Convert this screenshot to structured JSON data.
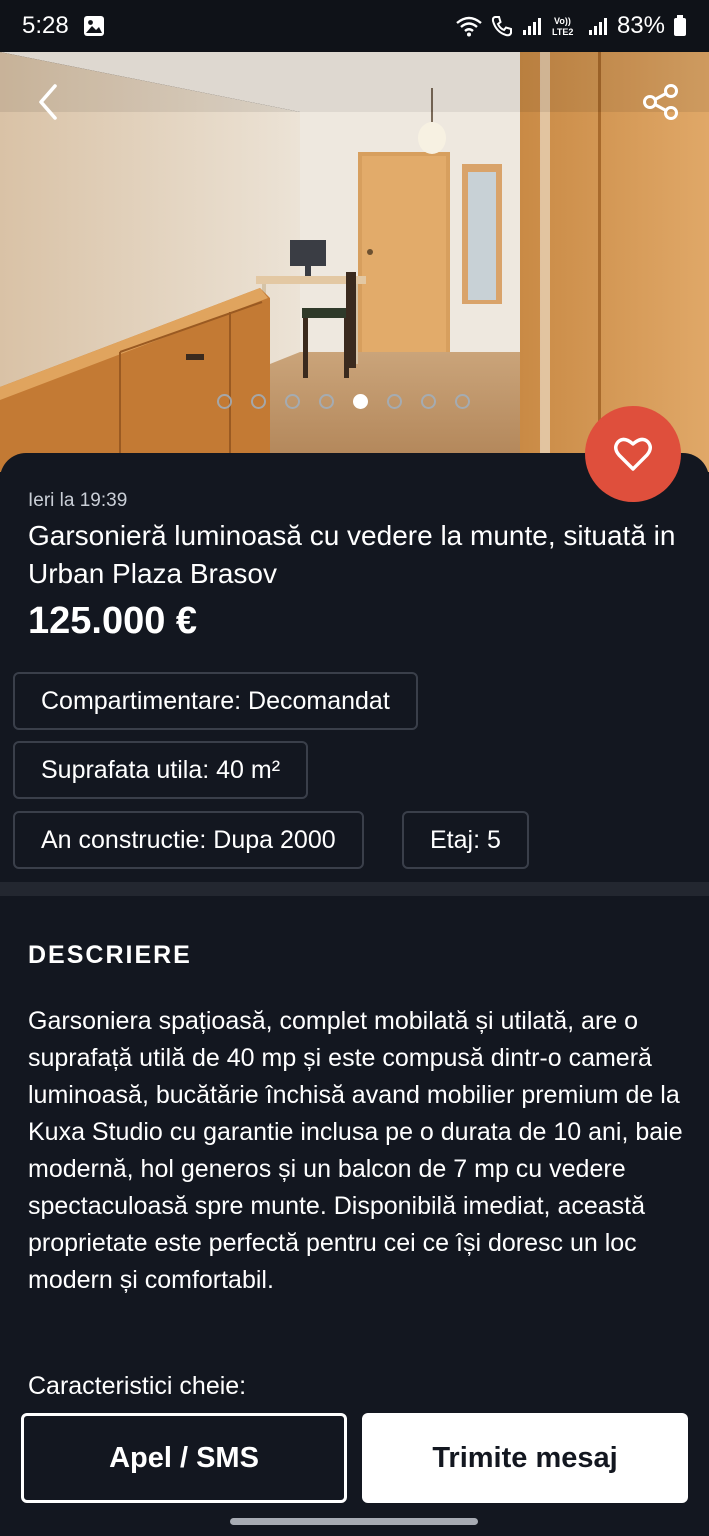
{
  "status_bar": {
    "time": "5:28",
    "battery": "83%",
    "icons": [
      "image-icon",
      "wifi-calling-icon",
      "phone-call-icon",
      "signal-icon",
      "volte-icon",
      "signal-icon",
      "battery-icon"
    ],
    "volte_text": "Vo)) LTE2"
  },
  "gallery": {
    "photo_count": 8,
    "active_index": 4,
    "icons": {
      "back": "back-arrow-icon",
      "share": "share-icon"
    }
  },
  "listing": {
    "posted": "Ieri la 19:39",
    "title": "Garsonieră luminoasă cu vedere la munte, situată in Urban Plaza Brasov",
    "price": "125.000 €",
    "favorite_icon": "heart-icon",
    "favorite_color": "#df4f3c",
    "attributes": [
      "Compartimentare: Decomandat",
      "Suprafata utila: 40 m²",
      "An constructie: Dupa 2000",
      "Etaj: 5"
    ]
  },
  "description": {
    "heading": "DESCRIERE",
    "text": "Garsoniera spațioasă, complet mobilată și utilată, are o suprafață utilă de 40 mp și este compusă dintr-o cameră luminoasă, bucătărie închisă avand mobilier premium de la Kuxa Studio cu garantie inclusa pe o durata de 10 ani, baie modernă, hol generos și un balcon de 7 mp cu vedere spectaculoasă spre munte. Disponibilă imediat, această proprietate este perfectă pentru cei ce își doresc un loc modern și comfortabil.",
    "key_features": "Caracteristici cheie:"
  },
  "actions": {
    "call_label": "Apel / SMS",
    "message_label": "Trimite mesaj"
  },
  "colors": {
    "background": "#131720",
    "accent": "#df4f3c"
  }
}
